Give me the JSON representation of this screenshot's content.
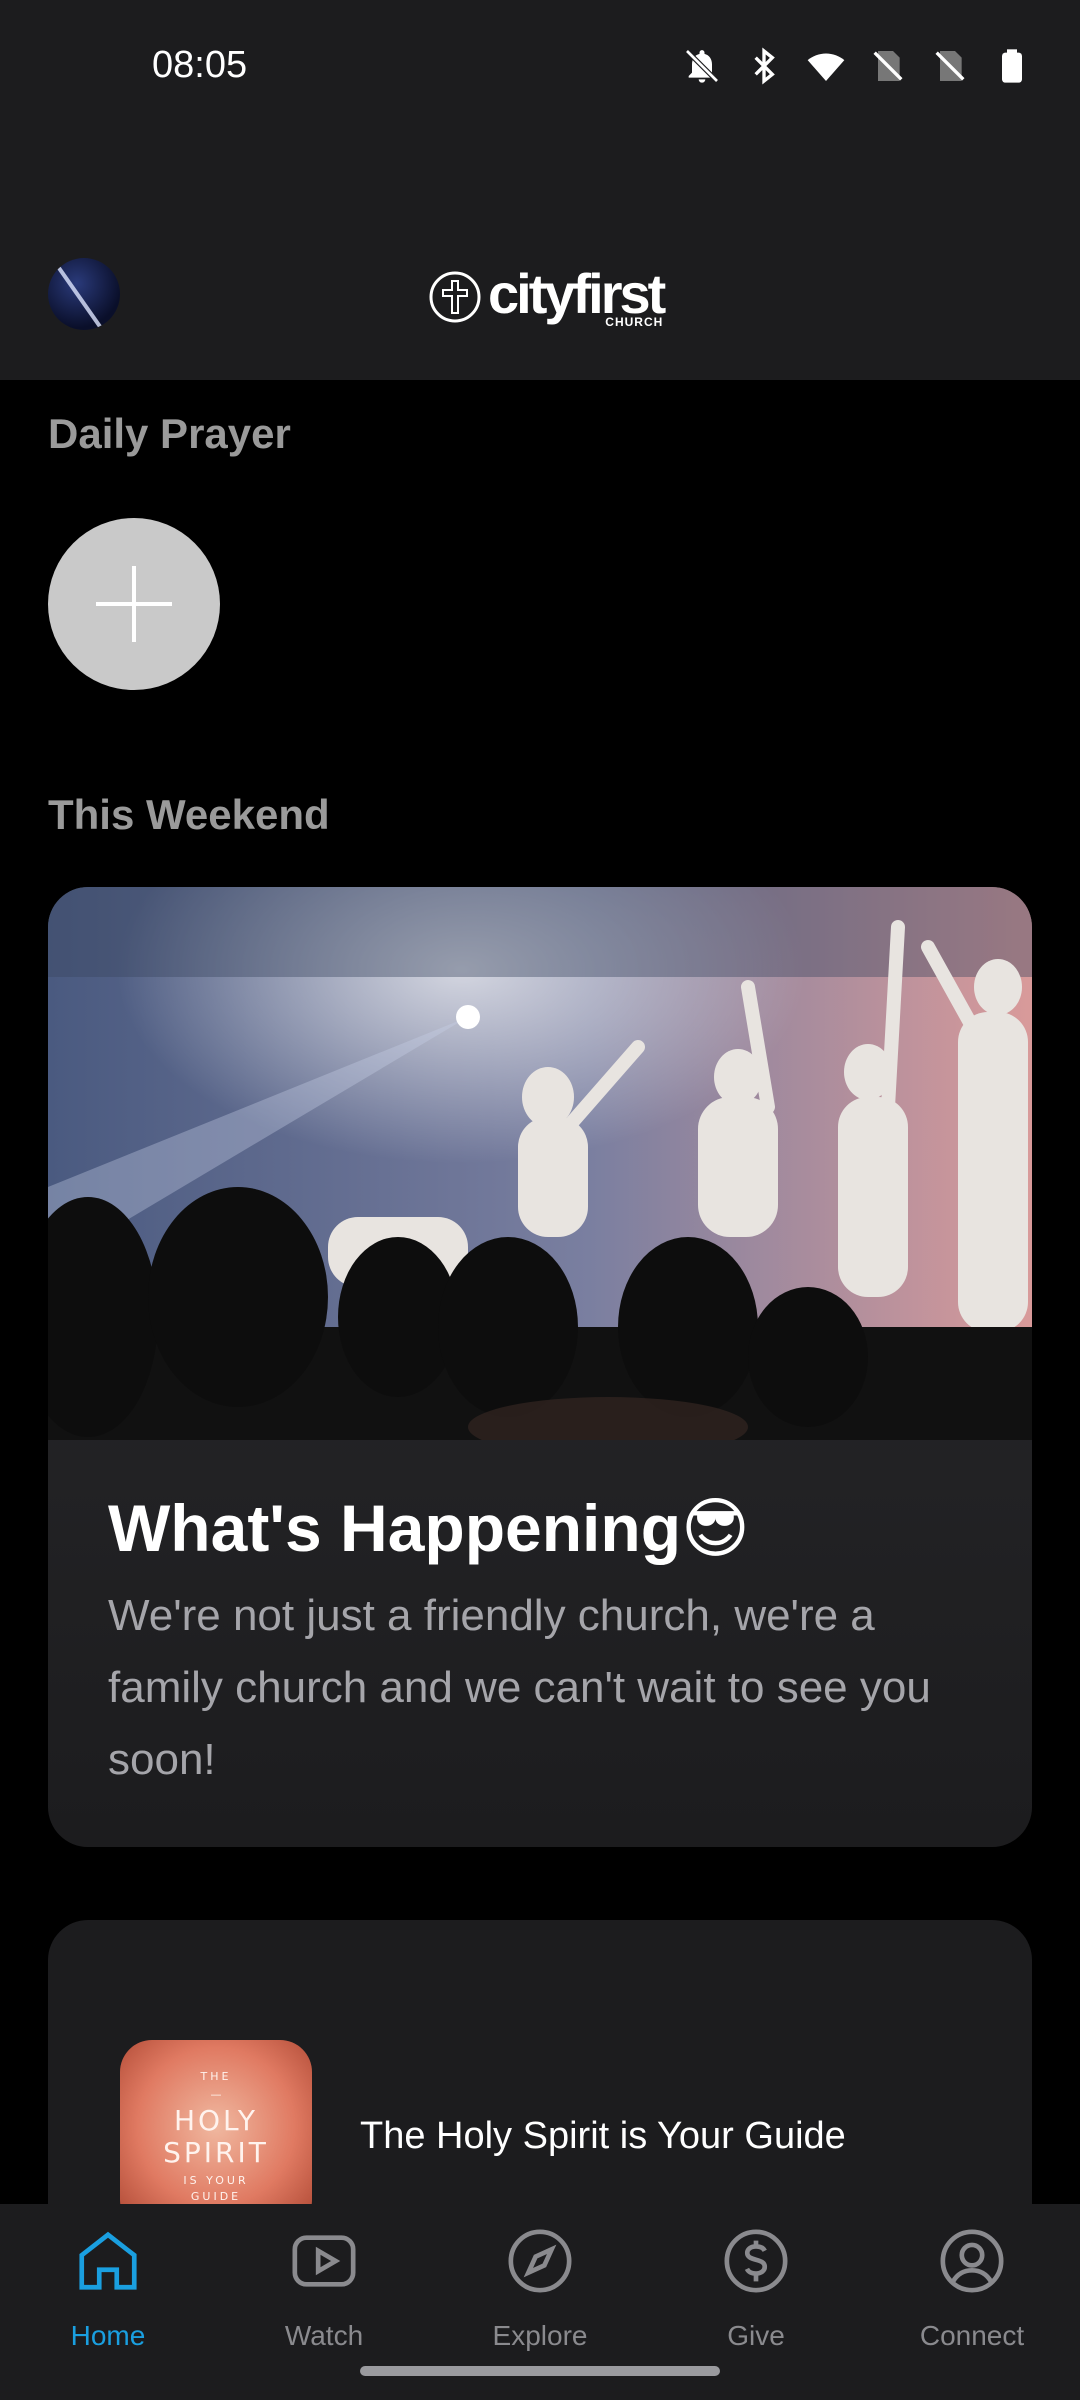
{
  "status_bar": {
    "time": "08:05",
    "icons": [
      "bell-off-icon",
      "bluetooth-icon",
      "wifi-icon",
      "no-sim-icon",
      "no-sim-icon",
      "battery-icon"
    ]
  },
  "header": {
    "logo_word": "cityfirst",
    "logo_sub": "CHURCH"
  },
  "daily_prayer": {
    "title": "Daily Prayer"
  },
  "this_weekend": {
    "title": "This Weekend",
    "card": {
      "title": "What's Happening",
      "emoji": "😎",
      "description": "We're not just a friendly church, we're a family church and we can't wait to see you soon!"
    }
  },
  "series": {
    "thumb_lines": [
      "THE",
      "—",
      "HOLY",
      "SPIRIT",
      "IS YOUR",
      "GUIDE"
    ],
    "title": "The Holy Spirit is Your Guide"
  },
  "bottom_nav": {
    "items": [
      {
        "label": "Home",
        "icon": "home-icon",
        "active": true
      },
      {
        "label": "Watch",
        "icon": "play-icon",
        "active": false
      },
      {
        "label": "Explore",
        "icon": "compass-icon",
        "active": false
      },
      {
        "label": "Give",
        "icon": "dollar-icon",
        "active": false
      },
      {
        "label": "Connect",
        "icon": "user-circle-icon",
        "active": false
      }
    ],
    "active_color": "#1a9fe0",
    "inactive_color": "#8a8a8e"
  }
}
